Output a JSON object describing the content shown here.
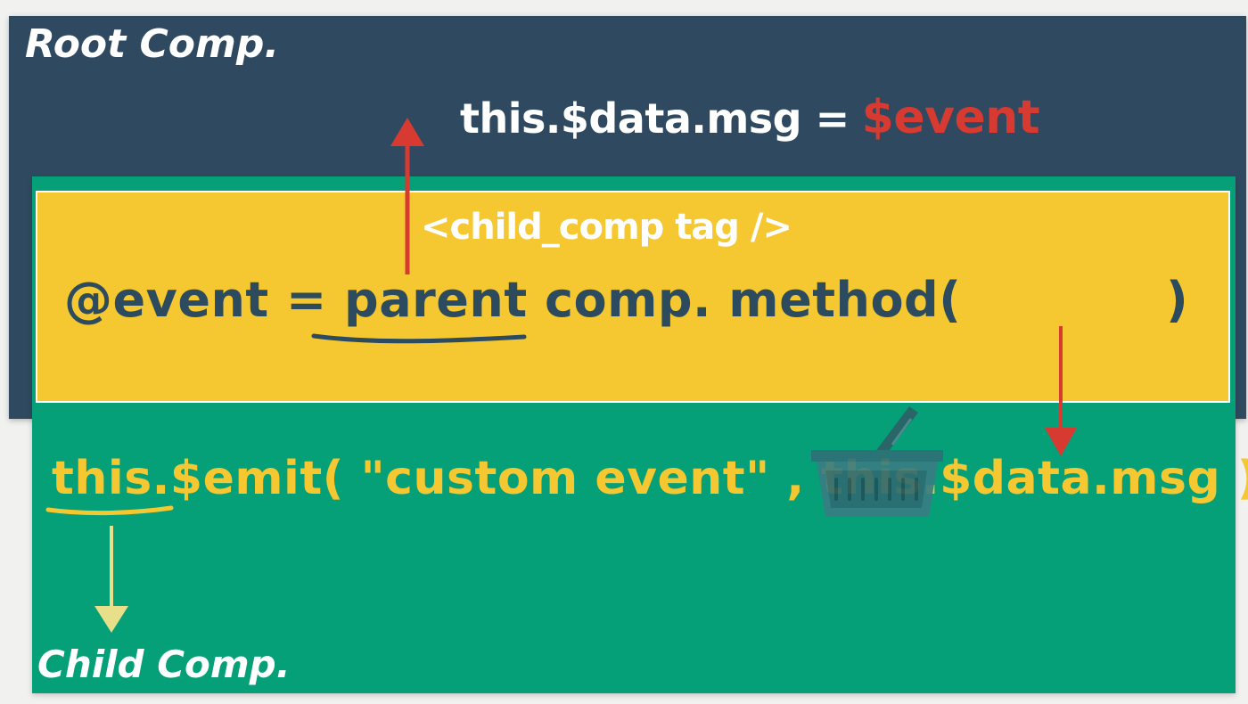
{
  "root": {
    "title": "Root Comp.",
    "assignment_code": "this.$data.msg =",
    "assignment_value": "$event"
  },
  "child_tag": {
    "label": "<child_comp tag />",
    "binding_text": "@event = parent comp. method(",
    "binding_close": ")"
  },
  "child": {
    "emit_text": "this.$emit( \"custom event\" , this.$data.msg )",
    "title": "Child Comp."
  },
  "icons": {
    "basket": "basket-icon"
  },
  "colors": {
    "root_background": "#2f4a60",
    "child_background": "#05a078",
    "tag_background": "#f5c730",
    "accent_red": "#d63a30",
    "text_white": "#ffffff",
    "text_dark": "#2d4b5e"
  }
}
